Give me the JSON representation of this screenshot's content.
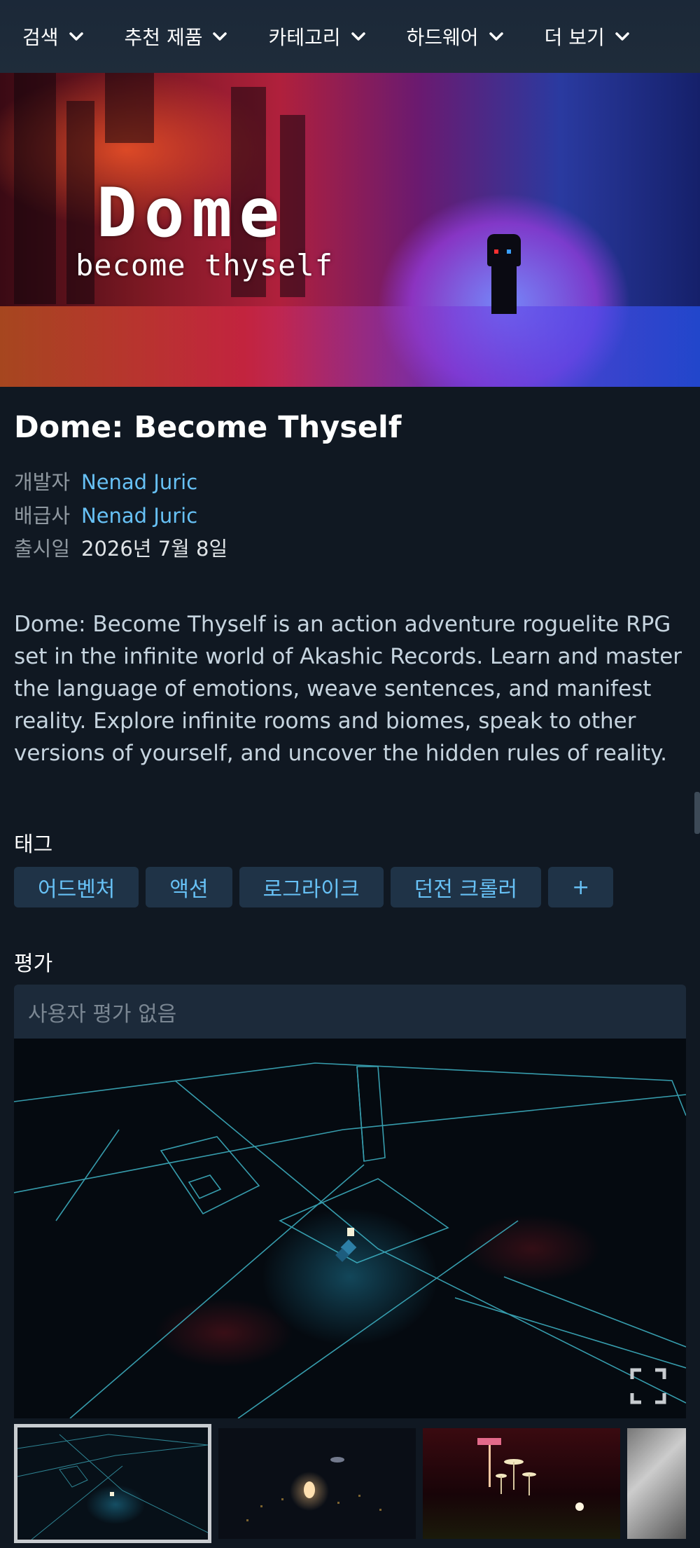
{
  "nav": {
    "items": [
      {
        "label": "검색"
      },
      {
        "label": "추천 제품"
      },
      {
        "label": "카테고리"
      },
      {
        "label": "하드웨어"
      },
      {
        "label": "더 보기"
      }
    ]
  },
  "hero": {
    "logo_title": "Dome",
    "logo_subtitle": "become thyself"
  },
  "game": {
    "title": "Dome: Become Thyself",
    "developer_label": "개발자",
    "developer": "Nenad Juric",
    "publisher_label": "배급사",
    "publisher": "Nenad Juric",
    "release_label": "출시일",
    "release_date": "2026년 7월 8일",
    "description": "Dome: Become Thyself is an action adventure roguelite RPG set in the infinite world of Akashic Records. Learn and master the language of emotions, weave sentences, and manifest reality. Explore infinite rooms and biomes, speak to other versions of yourself, and uncover the hidden rules of reality."
  },
  "tags": {
    "label": "태그",
    "items": [
      "어드벤처",
      "액션",
      "로그라이크",
      "던전 크롤러"
    ],
    "more": "+"
  },
  "reviews": {
    "label": "평가",
    "summary": "사용자 평가 없음"
  },
  "media": {
    "fullscreen_icon": "fullscreen-icon",
    "thumbnail_count": 4,
    "active_thumbnail": 1
  },
  "colors": {
    "background": "#101822",
    "link": "#67c1f5",
    "tag_bg": "#1f3347"
  }
}
